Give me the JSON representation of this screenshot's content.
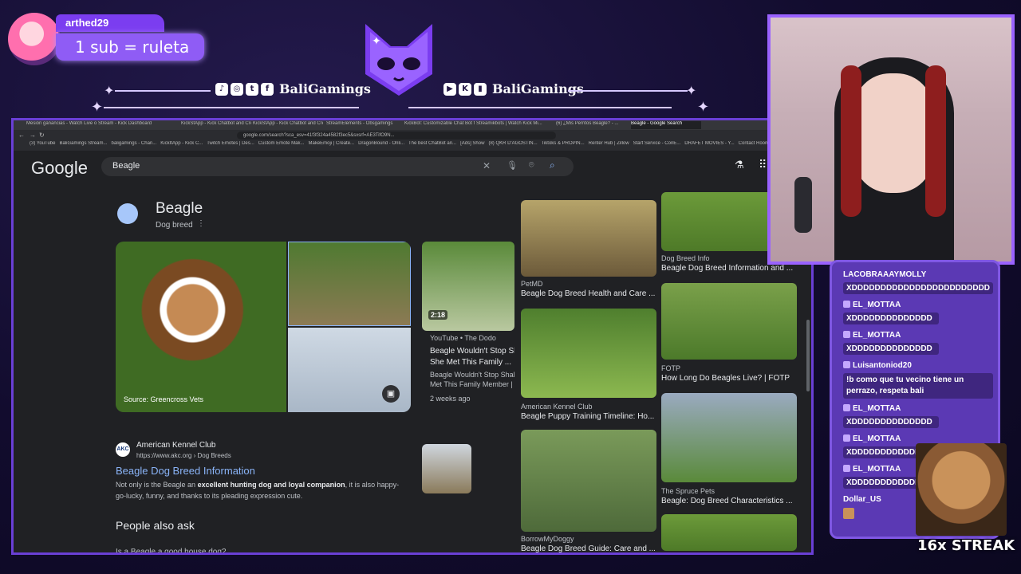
{
  "alert": {
    "user": "arthed29",
    "message": "1 sub = ruleta"
  },
  "socials": {
    "left": {
      "handle": "BaliGamings",
      "icons": [
        "tiktok-icon",
        "instagram-icon",
        "twitter-icon",
        "facebook-icon"
      ]
    },
    "right": {
      "handle": "BaliGamings",
      "icons": [
        "youtube-icon",
        "kick-icon",
        "twitch-icon"
      ]
    }
  },
  "browser": {
    "tabs": [
      "Mesión ganancias - Watch Live on",
      "Stream - Kick Dashboard",
      "KickStApp - Kick Chatbot and Cre",
      "KickStApp - Kick Chatbot and Cre",
      "StreamElements - Obsgamings",
      "KickBot: Customizable Chat Bot for",
      "Streamikbots | Watch Kick Mi...",
      "(6) ¿Mis Perritos Beagle? - ...",
      "Beagle - Google Search"
    ],
    "url": "google.com/search?sca_esv=41f3f324a4582f3ec5&sxsrf=AE3TifO9N...",
    "bookmarks": [
      "(3) YouTube",
      "BaliGamings Stream...",
      "baligamings - Chan...",
      "KickItApp - Kick C...",
      "Twitch Emotes | Des...",
      "Custom Emote Mak...",
      "MakeEmoji | Create...",
      "DragonBound - Onli...",
      "The best ChatBot an...",
      "[Ads] Show",
      "(8) QKR D'AGOSTIN...",
      "Tiktoks & PROPIN...",
      "Renter Hub | Zillow",
      "Start Service - ConE...",
      "DRAFET MOVIES - Y...",
      "Contact Room"
    ],
    "google": {
      "logo": "Google",
      "query": "Beagle"
    },
    "kp": {
      "title": "Beagle",
      "subtitle": "Dog breed",
      "source_label": "Source: Greencross Vets",
      "video": {
        "duration": "2:18",
        "channel": "YouTube • The Dodo",
        "title1": "Beagle Wouldn't Stop Sh",
        "title2": "She Met This Family ...",
        "desc1": "Beagle Wouldn't Stop Shaki",
        "desc2": "Met This Family Member | Th",
        "age": "2 weeks ago"
      }
    },
    "result": {
      "site": "American Kennel Club",
      "url": "https://www.akc.org › Dog Breeds",
      "title": "Beagle Dog Breed Information",
      "snippet1_pre": "Not only is the Beagle an ",
      "snippet1_bold": "excellent hunting dog and loyal companion",
      "snippet1_post": ", it is also happy-",
      "snippet2": "go-lucky, funny, and thanks to its pleading expression cute."
    },
    "paa": {
      "title": "People also ask",
      "first_q": "Is a Beagle a good house dog?"
    },
    "images": [
      {
        "source": "PetMD",
        "title": "Beagle Dog Breed Health and Care ..."
      },
      {
        "source": "Dog Breed Info",
        "title": "Beagle Dog Breed Information and ..."
      },
      {
        "source": "American Kennel Club",
        "title": "Beagle Puppy Training Timeline: Ho..."
      },
      {
        "source": "FOTP",
        "title": "How Long Do Beagles Live? | FOTP"
      },
      {
        "source": "BorrowMyDoggy",
        "title": "Beagle Dog Breed Guide: Care and ..."
      },
      {
        "source": "The Spruce Pets",
        "title": "Beagle: Dog Breed Characteristics ..."
      }
    ]
  },
  "chat": {
    "messages": [
      {
        "user": "LACOBRAAAYMOLLY",
        "text": "XDDDDDDDDDDDDDDDDDDDDDDDD"
      },
      {
        "user": "EL_MOTTAA",
        "text": "XDDDDDDDDDDDDDD"
      },
      {
        "user": "EL_MOTTAA",
        "text": "XDDDDDDDDDDDDDD"
      },
      {
        "user": "Luisantoniod20",
        "text": "!b como que tu vecino tiene un perrazo, respeta bali"
      },
      {
        "user": "EL_MOTTAA",
        "text": "XDDDDDDDDDDDDDD"
      },
      {
        "user": "EL_MOTTAA",
        "text": "XDDDDDDDDDDDDDD"
      },
      {
        "user": "EL_MOTTAA",
        "text": "XDDDDDDDDDDDDDD"
      },
      {
        "user": "Dollar_US",
        "text": ""
      }
    ]
  },
  "streak": "16x STREAK"
}
